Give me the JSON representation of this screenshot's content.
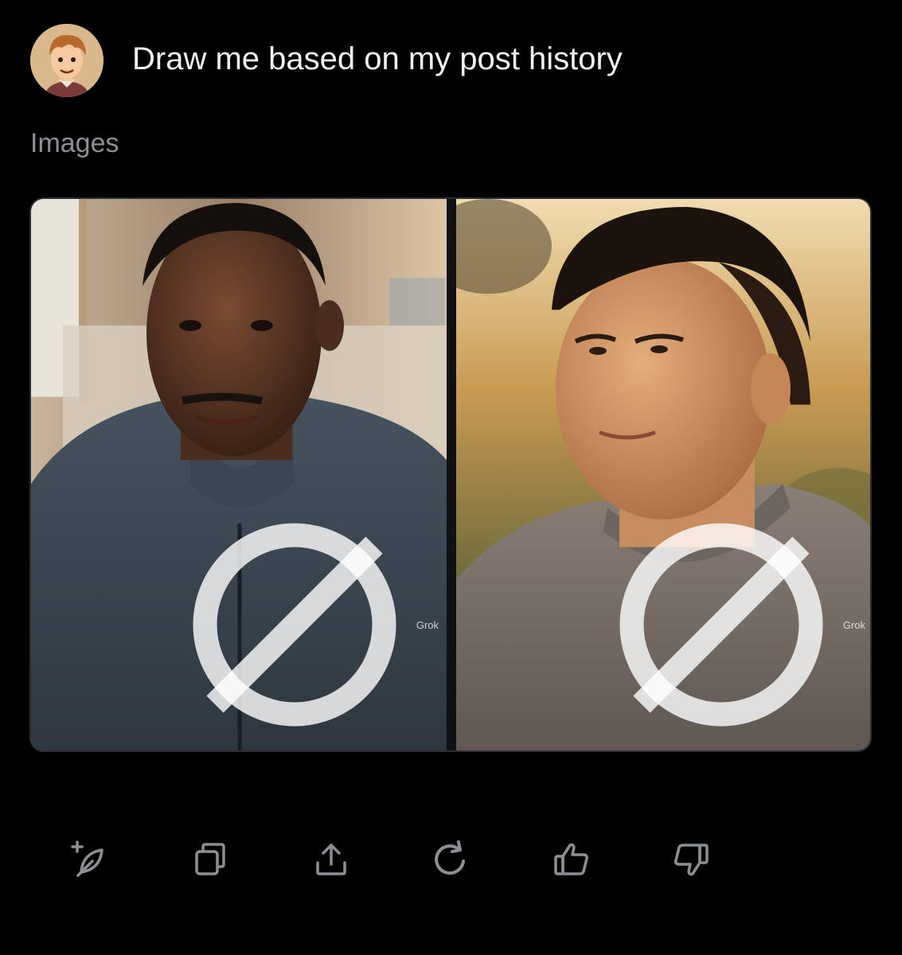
{
  "message": {
    "avatar_icon": "cartoon-avatar-icon",
    "prompt_text": "Draw me based on my post history"
  },
  "section": {
    "label": "Images"
  },
  "images": [
    {
      "description_icon": "portrait-image",
      "watermark": "Grok"
    },
    {
      "description_icon": "portrait-image",
      "watermark": "Grok"
    }
  ],
  "actions": [
    {
      "icon": "edit-image-icon"
    },
    {
      "icon": "copy-icon"
    },
    {
      "icon": "share-icon"
    },
    {
      "icon": "regenerate-icon"
    },
    {
      "icon": "thumbs-up-icon"
    },
    {
      "icon": "thumbs-down-icon"
    }
  ],
  "colors": {
    "background": "#000000",
    "text_primary": "#f2f2f2",
    "text_secondary": "#8b8f94",
    "icon": "#8b8f94"
  }
}
